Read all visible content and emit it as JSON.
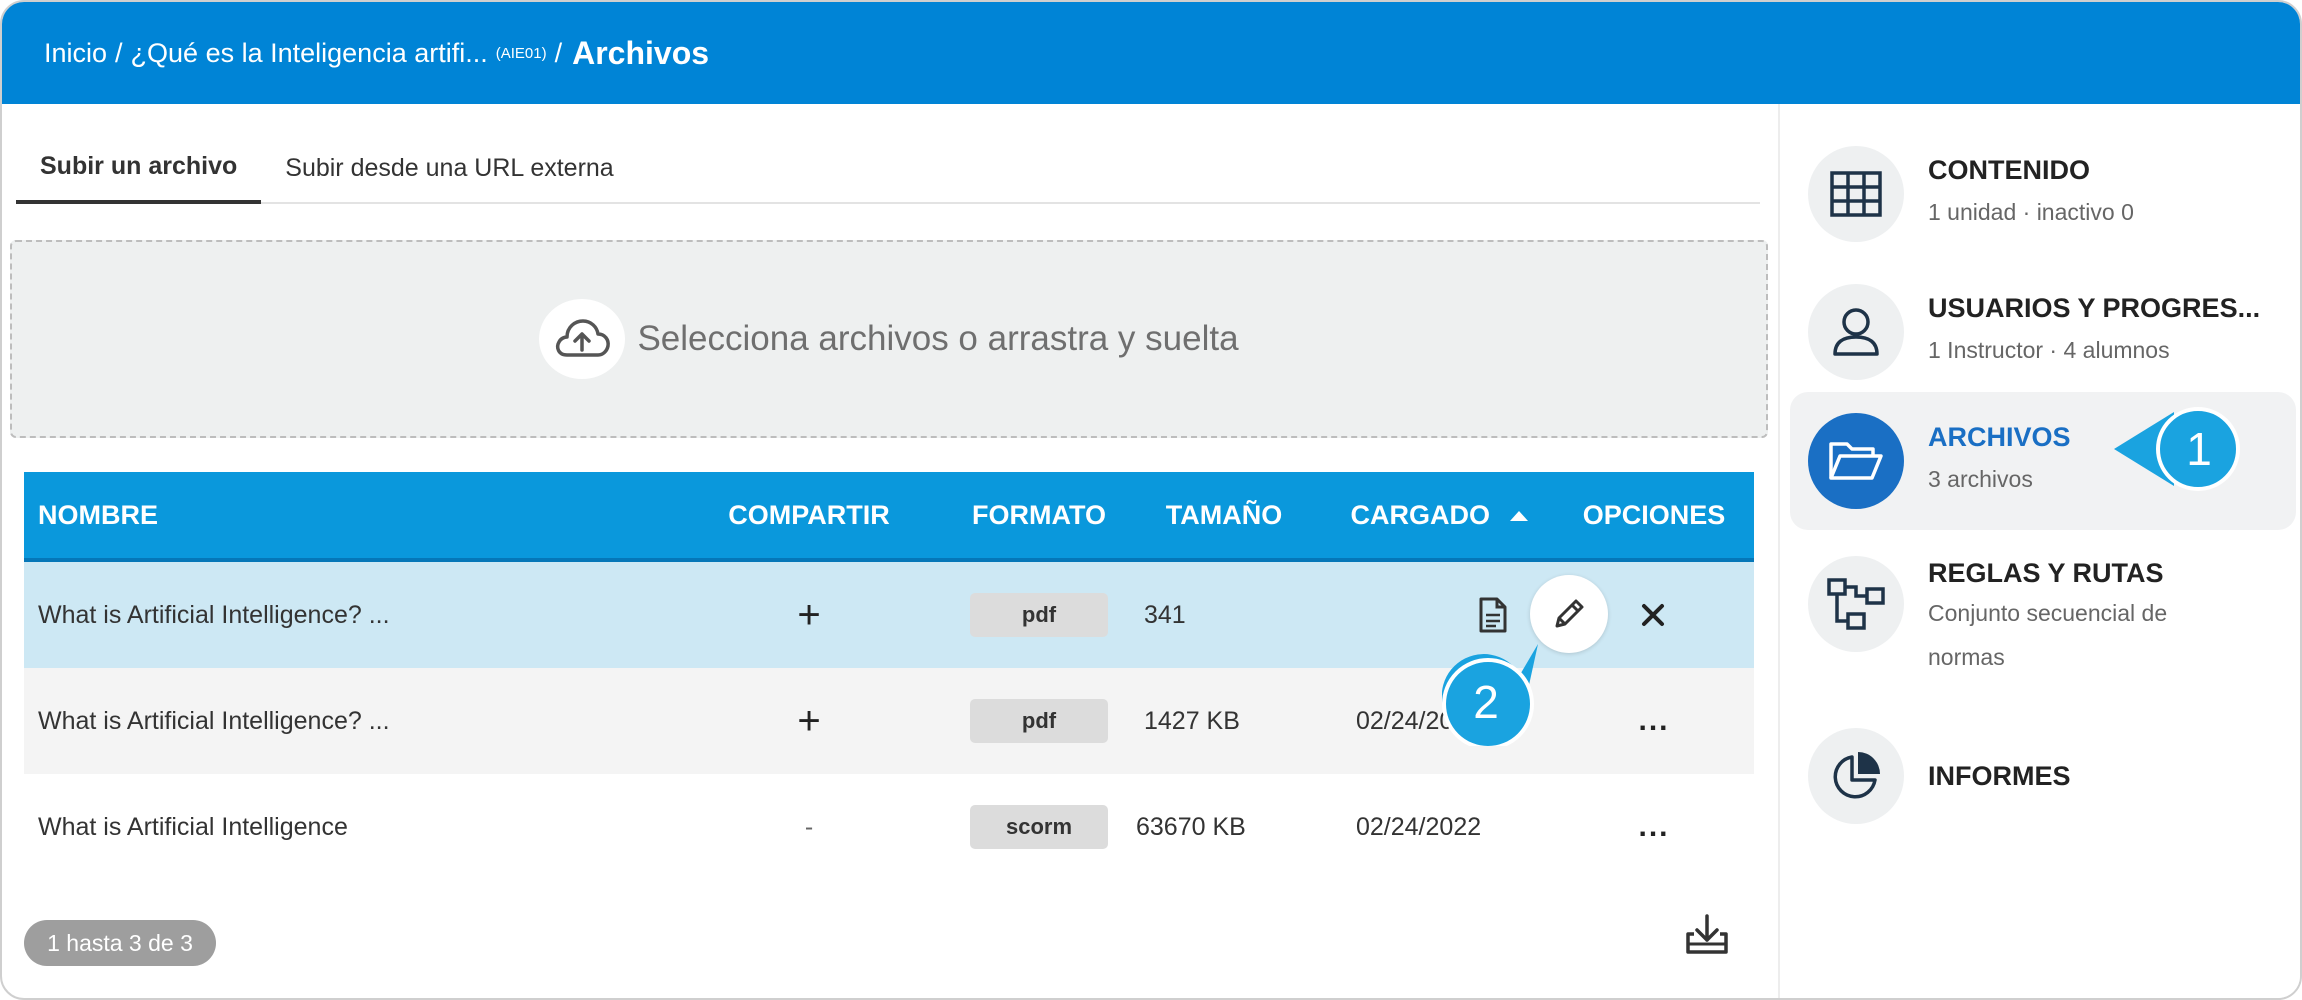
{
  "breadcrumb": {
    "home": "Inicio",
    "separator": "/",
    "course": "¿Qué es la Inteligencia artifi...",
    "course_code": "(AIE01)",
    "current": "Archivos"
  },
  "tabs": [
    {
      "label": "Subir un archivo",
      "active": true
    },
    {
      "label": "Subir desde una URL externa",
      "active": false
    }
  ],
  "dropzone": {
    "text": "Selecciona archivos o arrastra y suelta",
    "icon": "cloud-upload-icon"
  },
  "table": {
    "headers": {
      "name": "NOMBRE",
      "share": "COMPARTIR",
      "format": "FORMATO",
      "size": "TAMAÑO",
      "uploaded": "CARGADO",
      "options": "OPCIONES"
    },
    "rows": [
      {
        "name": "What is Artificial Intelligence? ...",
        "share": "+",
        "format": "pdf",
        "size": "341",
        "uploaded": "",
        "options": "hover-actions"
      },
      {
        "name": "What is Artificial Intelligence? ...",
        "share": "+",
        "format": "pdf",
        "size": "1427 KB",
        "uploaded": "02/24/2022",
        "options": "..."
      },
      {
        "name": "What is Artificial Intelligence",
        "share": "-",
        "format": "scorm",
        "size": "63670 KB",
        "uploaded": "02/24/2022",
        "options": "..."
      }
    ]
  },
  "pager": {
    "text": "1 hasta 3 de 3"
  },
  "sidebar": {
    "items": [
      {
        "title": "CONTENIDO",
        "subtitle": "1 unidad · inactivo 0",
        "icon": "grid-icon",
        "active": false
      },
      {
        "title": "USUARIOS Y PROGRES...",
        "subtitle": "1 Instructor · 4 alumnos",
        "icon": "user-icon",
        "active": false
      },
      {
        "title": "ARCHIVOS",
        "subtitle": "3 archivos",
        "icon": "folder-open-icon",
        "active": true
      },
      {
        "title": "REGLAS Y RUTAS",
        "subtitle": "Conjunto secuencial de normas",
        "icon": "flow-icon",
        "active": false
      },
      {
        "title": "INFORMES",
        "subtitle": "",
        "icon": "pie-chart-icon",
        "active": false
      }
    ]
  },
  "callouts": {
    "one": "1",
    "two": "2"
  },
  "colors": {
    "header": "#0084d6",
    "table_header": "#0a98dc",
    "selected_row": "#cde8f4",
    "active_nav": "#1a6fc4",
    "callout": "#1aa3e0"
  }
}
